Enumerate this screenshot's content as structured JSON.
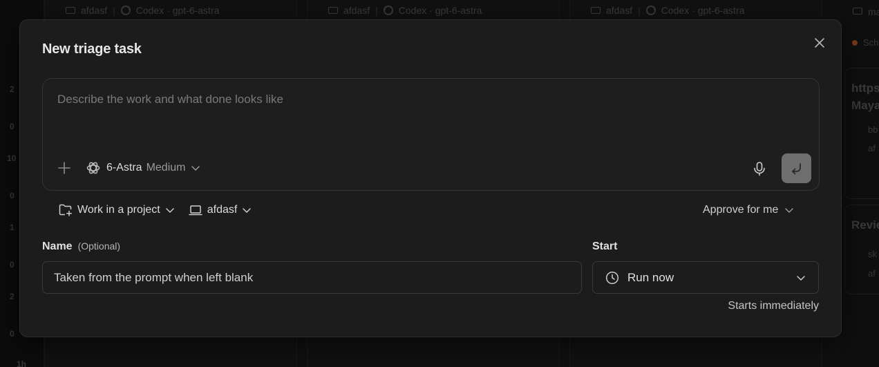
{
  "background": {
    "card_project": "afdasf",
    "card_agent": "Codex · gpt-6-astra",
    "right_edge_top": "ma",
    "right_edge_status": "Sch",
    "right_edge_card1_title_l1": "https",
    "right_edge_card1_title_l2": "Maya",
    "right_edge_card1_line1": "bb",
    "right_edge_card1_line2": "af",
    "right_edge_card2_title": "Revie",
    "right_edge_card2_line1": "sk",
    "right_edge_card2_line2": "af",
    "left_rail_numbers": [
      "2",
      "0",
      "10",
      "0",
      "1",
      "0",
      "2",
      "0",
      "1h"
    ]
  },
  "modal": {
    "title": "New triage task",
    "composer": {
      "placeholder": "Describe the work and what done looks like",
      "model_name": "6-Astra",
      "model_effort": "Medium"
    },
    "options": {
      "project_label": "Work in a project",
      "environment_label": "afdasf",
      "approval_label": "Approve for me"
    },
    "name_field": {
      "label": "Name",
      "optional": "(Optional)",
      "placeholder": "Taken from the prompt when left blank",
      "value": ""
    },
    "start_field": {
      "label": "Start",
      "value": "Run now",
      "helper": "Starts immediately"
    }
  },
  "icons": {
    "close": "close-icon",
    "plus": "plus-icon",
    "model": "openai-logo-icon",
    "mic": "microphone-icon",
    "send": "send-arrow-icon",
    "project": "folder-plus-icon",
    "environment": "laptop-icon",
    "clock": "clock-icon",
    "chevron": "chevron-down-icon"
  },
  "colors": {
    "modal_bg": "#1c1c1c",
    "send_button": "#6e6e6e",
    "status_dot": "#7a3a1a"
  }
}
